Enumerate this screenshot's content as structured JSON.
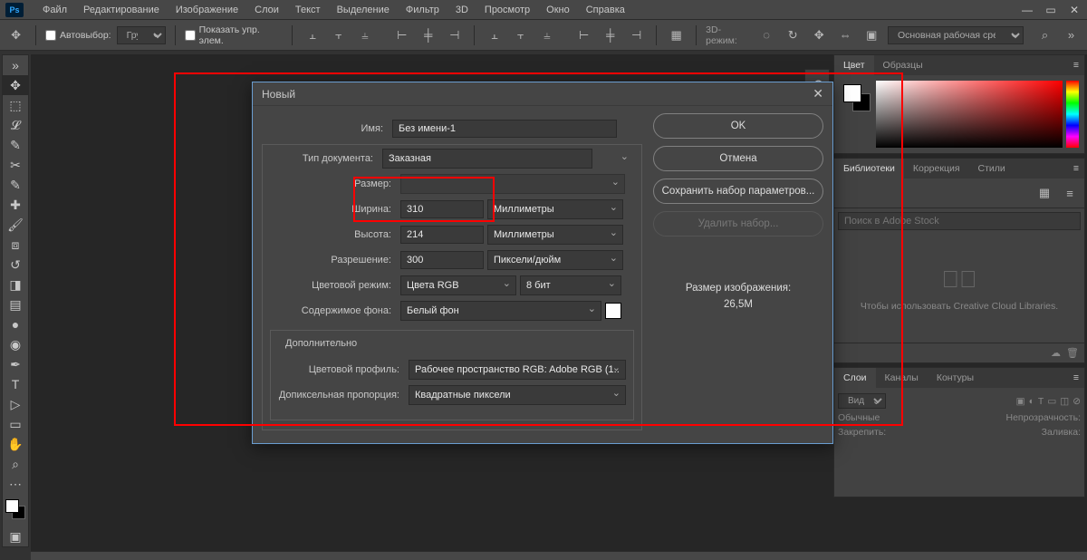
{
  "app": {
    "logo": "Ps"
  },
  "menubar": {
    "items": [
      "Файл",
      "Редактирование",
      "Изображение",
      "Слои",
      "Текст",
      "Выделение",
      "Фильтр",
      "3D",
      "Просмотр",
      "Окно",
      "Справка"
    ]
  },
  "options": {
    "auto_select_label": "Автовыбор:",
    "group": "Группа",
    "show_transform_label": "Показать упр. элем.",
    "mode3d": "3D-режим:",
    "workspace": "Основная рабочая среда"
  },
  "panels": {
    "color": {
      "tabs": [
        "Цвет",
        "Образцы"
      ],
      "active": 0
    },
    "props": {
      "tabs": [
        "Библиотеки",
        "Коррекция",
        "Стили"
      ],
      "active": 0,
      "search_placeholder": "Поиск в Adobe Stock",
      "cc_message": "Чтобы использовать Creative Cloud Libraries."
    },
    "layers": {
      "tabs": [
        "Слои",
        "Каналы",
        "Контуры"
      ],
      "active": 0,
      "blend": "Вид",
      "normal": "Обычные",
      "opacity_label": "Непрозрачность:",
      "lock_label": "Закрепить:",
      "fill_label": "Заливка:"
    }
  },
  "dialog": {
    "title": "Новый",
    "name_label": "Имя:",
    "name_value": "Без имени-1",
    "doctype_label": "Тип документа:",
    "doctype": "Заказная",
    "size_label": "Размер:",
    "width_label": "Ширина:",
    "width_value": "310",
    "width_unit": "Миллиметры",
    "height_label": "Высота:",
    "height_value": "214",
    "height_unit": "Миллиметры",
    "resolution_label": "Разрешение:",
    "resolution_value": "300",
    "resolution_unit": "Пиксели/дюйм",
    "color_mode_label": "Цветовой режим:",
    "color_mode": "Цвета RGB",
    "bit_depth": "8 бит",
    "bg_label": "Содержимое фона:",
    "bg": "Белый фон",
    "advanced_label": "Дополнительно",
    "profile_label": "Цветовой профиль:",
    "profile": "Рабочее пространство RGB:  Adobe RGB (1...",
    "pixel_aspect_label": "Допиксельная пропорция:",
    "pixel_aspect": "Квадратные пиксели",
    "ok": "OK",
    "cancel": "Отмена",
    "save_preset": "Сохранить набор параметров...",
    "delete_preset": "Удалить набор...",
    "img_size_label": "Размер изображения:",
    "img_size": "26,5M"
  }
}
